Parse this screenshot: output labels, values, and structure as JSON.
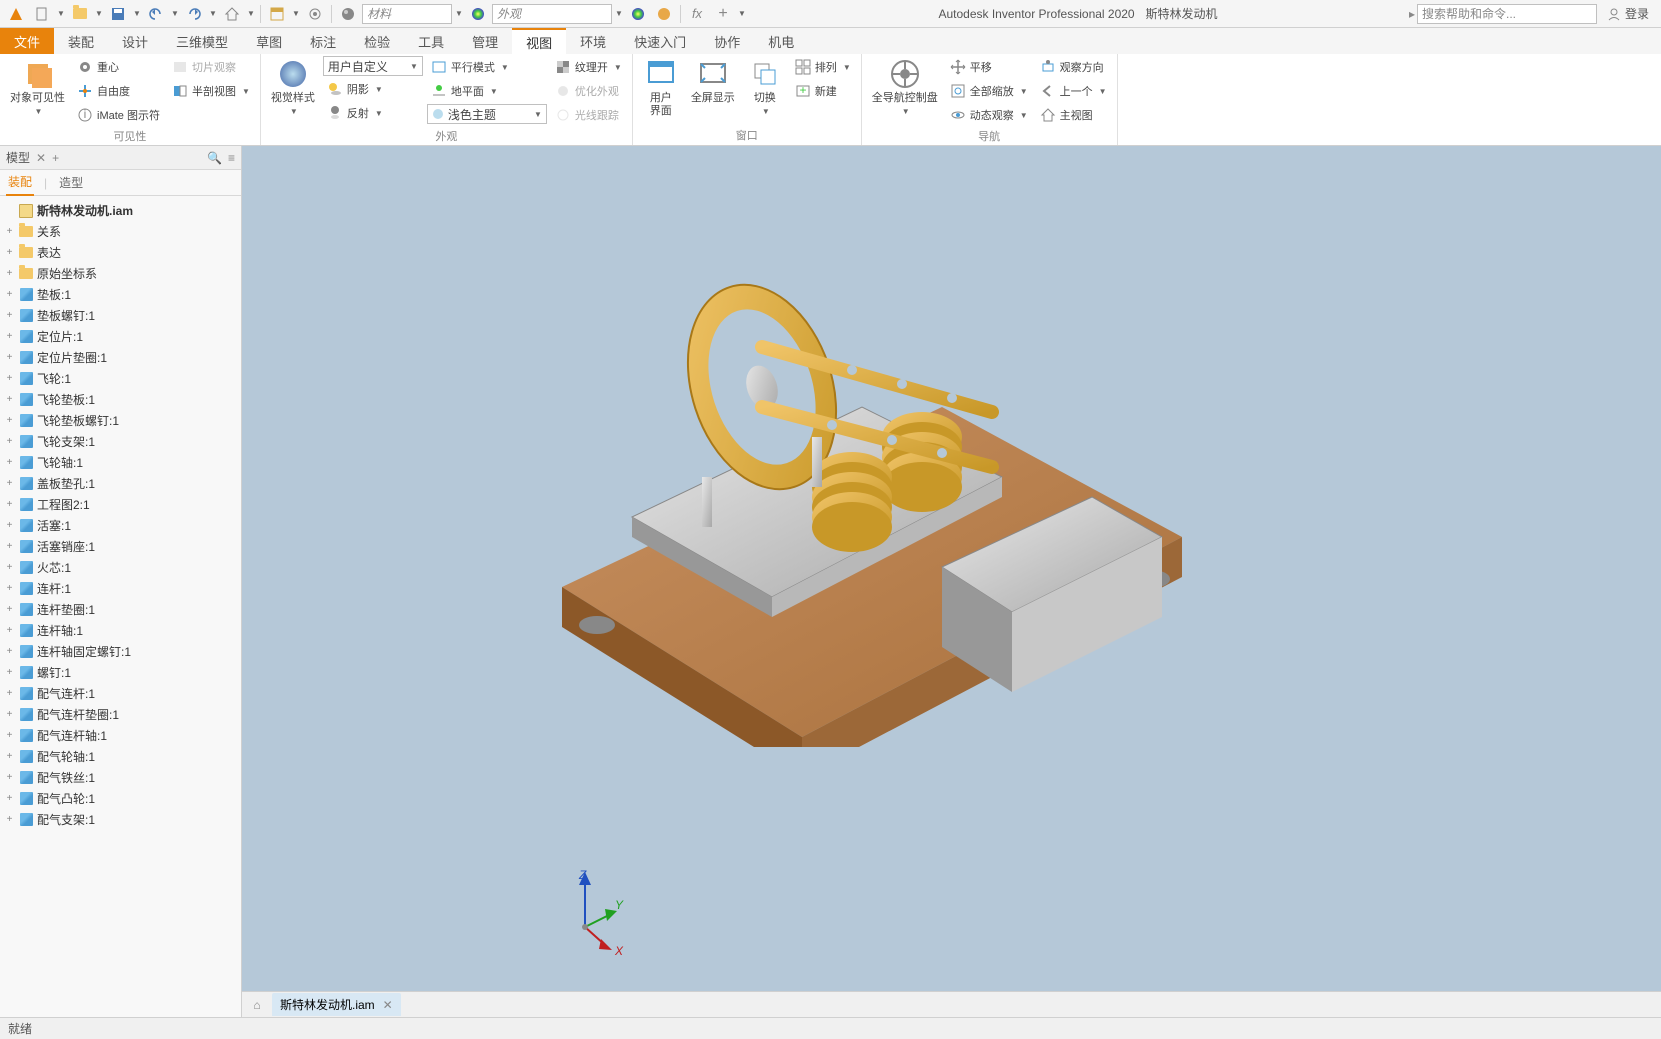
{
  "app": {
    "title": "Autodesk Inventor Professional 2020",
    "docname": "斯特林发动机"
  },
  "qat": {
    "material_placeholder": "材料",
    "appearance_placeholder": "外观",
    "search_placeholder": "搜索帮助和命令...",
    "login": "登录"
  },
  "tabs": {
    "file": "文件",
    "list": [
      "装配",
      "设计",
      "三维模型",
      "草图",
      "标注",
      "检验",
      "工具",
      "管理",
      "视图",
      "环境",
      "快速入门",
      "协作",
      "机电"
    ],
    "active": "视图"
  },
  "ribbon": {
    "visibility": {
      "title": "可见性",
      "object_visibility": "对象可见性",
      "center_of_gravity": "重心",
      "dof": "自由度",
      "imate": "iMate 图示符",
      "slice_view": "切片观察",
      "half_section": "半剖视图"
    },
    "appearance": {
      "title": "外观",
      "visual_style": "视觉样式",
      "user_defined": "用户自定义",
      "shadow": "阴影",
      "reflection": "反射",
      "parallel_mode": "平行模式",
      "ground_plane": "地平面",
      "light_theme": "浅色主题",
      "texture_on": "纹理开",
      "refine_appearance": "优化外观",
      "ray_tracing": "光线跟踪"
    },
    "window": {
      "title": "窗口",
      "ui": "用户\n界面",
      "fullscreen": "全屏显示",
      "switch": "切换",
      "arrange": "排列",
      "new": "新建"
    },
    "navigate": {
      "title": "导航",
      "steering_wheel": "全导航控制盘",
      "pan": "平移",
      "zoom_all": "全部缩放",
      "orbit": "动态观察",
      "look_at": "观察方向",
      "previous": "上一个",
      "home_view": "主视图"
    }
  },
  "browser": {
    "header": "模型",
    "tabs": {
      "assembly": "装配",
      "modeling": "造型"
    },
    "root": "斯特林发动机.iam",
    "folders": [
      "关系",
      "表达",
      "原始坐标系"
    ],
    "parts": [
      "垫板:1",
      "垫板螺钉:1",
      "定位片:1",
      "定位片垫圈:1",
      "飞轮:1",
      "飞轮垫板:1",
      "飞轮垫板螺钉:1",
      "飞轮支架:1",
      "飞轮轴:1",
      "盖板垫孔:1",
      "工程图2:1",
      "活塞:1",
      "活塞销座:1",
      "火芯:1",
      "连杆:1",
      "连杆垫圈:1",
      "连杆轴:1",
      "连杆轴固定螺钉:1",
      "螺钉:1",
      "配气连杆:1",
      "配气连杆垫圈:1",
      "配气连杆轴:1",
      "配气轮轴:1",
      "配气铁丝:1",
      "配气凸轮:1",
      "配气支架:1"
    ]
  },
  "doctab": {
    "name": "斯特林发动机.iam"
  },
  "triad": {
    "x": "X",
    "y": "Y",
    "z": "Z"
  },
  "status": {
    "ready": "就绪"
  }
}
